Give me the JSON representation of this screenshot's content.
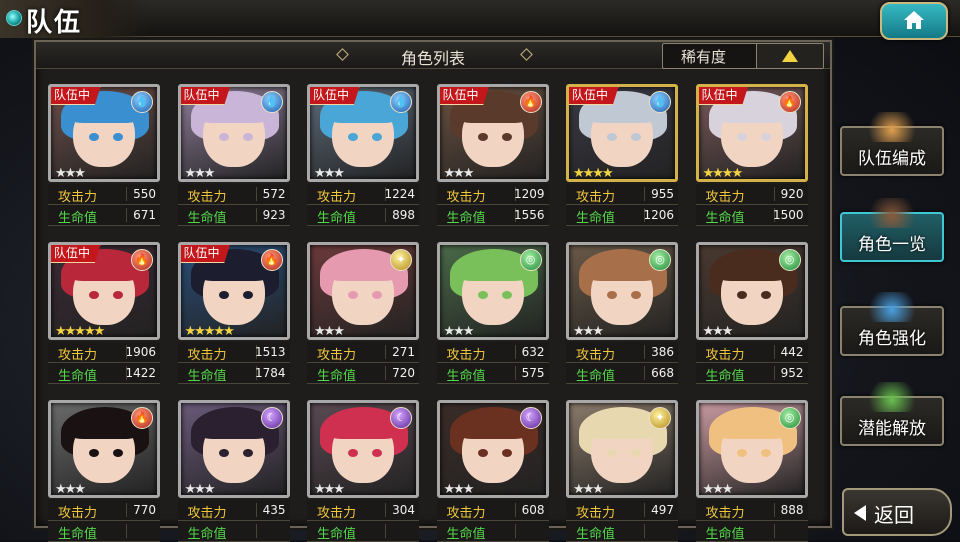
{
  "header": {
    "title": "队伍",
    "home_icon": "home-icon"
  },
  "list": {
    "title": "角色列表",
    "sort_label": "稀有度",
    "sort_icon": "triangle-up-icon"
  },
  "stat_labels": {
    "atk": "攻击力",
    "hp": "生命值"
  },
  "badge_text": "队伍中",
  "cards": [
    {
      "in_team": true,
      "element": "water",
      "stars": 3,
      "atk": "550",
      "hp": "671",
      "hair": "#3a8fd1",
      "bg": "#6c4f4a"
    },
    {
      "in_team": true,
      "element": "water",
      "stars": 3,
      "atk": "572",
      "hp": "923",
      "hair": "#c9b5d8",
      "bg": "#8f7f9a"
    },
    {
      "in_team": true,
      "element": "water",
      "stars": 3,
      "atk": "1224",
      "hp": "898",
      "hair": "#4aa6d6",
      "bg": "#5d6b7a"
    },
    {
      "in_team": true,
      "element": "fire",
      "stars": 3,
      "atk": "1209",
      "hp": "1556",
      "hair": "#5a3a2a",
      "bg": "#6b5240"
    },
    {
      "in_team": true,
      "element": "water",
      "stars": 4,
      "atk": "955",
      "hp": "1206",
      "hair": "#c0c8d4",
      "bg": "#3a3a44",
      "gold": true
    },
    {
      "in_team": true,
      "element": "fire",
      "stars": 4,
      "atk": "920",
      "hp": "1500",
      "hair": "#d8d2dc",
      "bg": "#7a5a5a",
      "gold": true
    },
    {
      "in_team": true,
      "element": "fire",
      "stars": 5,
      "atk": "1906",
      "hp": "1422",
      "hair": "#b8283a",
      "bg": "#3b2a34"
    },
    {
      "in_team": true,
      "element": "fire",
      "stars": 5,
      "atk": "1513",
      "hp": "1784",
      "hair": "#1c1e30",
      "bg": "#2a4f7a"
    },
    {
      "in_team": false,
      "element": "light",
      "stars": 3,
      "atk": "271",
      "hp": "720",
      "hair": "#e59ab0",
      "bg": "#6b3a3a"
    },
    {
      "in_team": false,
      "element": "wind",
      "stars": 3,
      "atk": "632",
      "hp": "575",
      "hair": "#7ac05a",
      "bg": "#4a6a48"
    },
    {
      "in_team": false,
      "element": "wind",
      "stars": 3,
      "atk": "386",
      "hp": "668",
      "hair": "#a8704a",
      "bg": "#6a5a48"
    },
    {
      "in_team": false,
      "element": "wind",
      "stars": 3,
      "atk": "442",
      "hp": "952",
      "hair": "#4a2c1e",
      "bg": "#4a3a30"
    },
    {
      "in_team": false,
      "element": "fire",
      "stars": 3,
      "atk": "770",
      "hp": "",
      "hair": "#1a1212",
      "bg": "#6a6a6a"
    },
    {
      "in_team": false,
      "element": "dark",
      "stars": 3,
      "atk": "435",
      "hp": "",
      "hair": "#2a2030",
      "bg": "#6a5a7a"
    },
    {
      "in_team": false,
      "element": "dark",
      "stars": 3,
      "atk": "304",
      "hp": "",
      "hair": "#d03050",
      "bg": "#5a4a52"
    },
    {
      "in_team": false,
      "element": "dark",
      "stars": 3,
      "atk": "608",
      "hp": "",
      "hair": "#6a3020",
      "bg": "#3a2c28"
    },
    {
      "in_team": false,
      "element": "light",
      "stars": 3,
      "atk": "497",
      "hp": "",
      "hair": "#e8d8b0",
      "bg": "#8a7a6a"
    },
    {
      "in_team": false,
      "element": "wind",
      "stars": 3,
      "atk": "888",
      "hp": "",
      "hair": "#f0c080",
      "bg": "#c89aa0"
    }
  ],
  "side_buttons": [
    {
      "label": "队伍编成",
      "icon": "party-portraits-icon",
      "active": false
    },
    {
      "label": "角色一览",
      "icon": "book-icon",
      "active": true
    },
    {
      "label": "角色强化",
      "icon": "enhance-crystal-icon",
      "active": false
    },
    {
      "label": "潜能解放",
      "icon": "potential-orb-icon",
      "active": false
    }
  ],
  "back": {
    "label": "返回",
    "icon": "back-arrow-icon"
  },
  "colors": {
    "accent": "#3fc7d4",
    "atk_label": "#efc63c",
    "hp_label": "#54d64a",
    "badge": "#c3171b",
    "star": "#f2d342"
  }
}
